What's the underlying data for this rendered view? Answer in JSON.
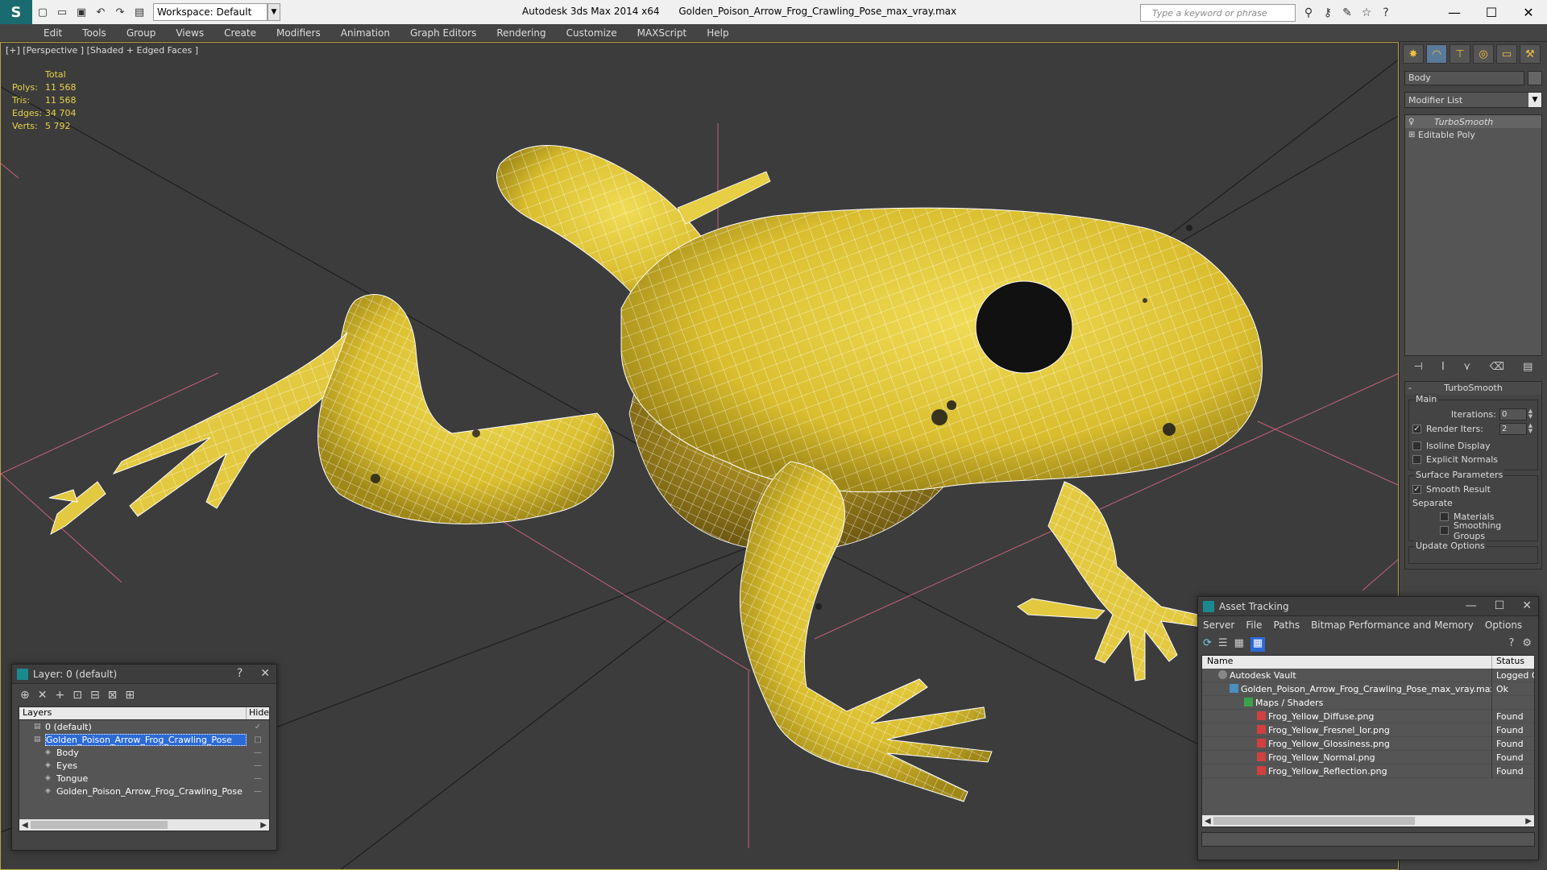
{
  "titlebar": {
    "app_name": "Autodesk 3ds Max  2014 x64",
    "file_name": "Golden_Poison_Arrow_Frog_Crawling_Pose_max_vray.max",
    "workspace": "Workspace: Default",
    "search_placeholder": "Type a keyword or phrase"
  },
  "menu": [
    "Edit",
    "Tools",
    "Group",
    "Views",
    "Create",
    "Modifiers",
    "Animation",
    "Graph Editors",
    "Rendering",
    "Customize",
    "MAXScript",
    "Help"
  ],
  "viewport": {
    "label": "[+] [Perspective ] [Shaded + Edged Faces ]",
    "stats": {
      "header": "Total",
      "rows": [
        {
          "key": "Polys:",
          "value": "11 568"
        },
        {
          "key": "Tris:",
          "value": "11 568"
        },
        {
          "key": "Edges:",
          "value": "34 704"
        },
        {
          "key": "Verts:",
          "value": "5 792"
        }
      ]
    }
  },
  "command_panel": {
    "object_name": "Body",
    "modifier_list": "Modifier List",
    "stack": [
      "TurboSmooth",
      "Editable Poly"
    ],
    "rollout": {
      "title": "TurboSmooth",
      "main_group": "Main",
      "iterations_label": "Iterations:",
      "iterations_value": "0",
      "render_iters_label": "Render Iters:",
      "render_iters_value": "2",
      "isoline_label": "Isoline Display",
      "explicit_normals_label": "Explicit Normals",
      "surface_group": "Surface Parameters",
      "smooth_result_label": "Smooth Result",
      "separate_label": "Separate",
      "materials_label": "Materials",
      "smoothing_groups_label": "Smoothing Groups",
      "update_options_label": "Update Options"
    }
  },
  "layer_window": {
    "title": "Layer: 0 (default)",
    "help": "?",
    "col_layers": "Layers",
    "col_hide": "Hide",
    "rows": [
      {
        "name": "0 (default)",
        "indent": 1,
        "checked": true
      },
      {
        "name": "Golden_Poison_Arrow_Frog_Crawling_Pose",
        "indent": 1,
        "selected": true
      },
      {
        "name": "Body",
        "indent": 2
      },
      {
        "name": "Eyes",
        "indent": 2
      },
      {
        "name": "Tongue",
        "indent": 2
      },
      {
        "name": "Golden_Poison_Arrow_Frog_Crawling_Pose",
        "indent": 2
      }
    ]
  },
  "asset_window": {
    "title": "Asset Tracking",
    "menu": [
      "Server",
      "File",
      "Paths",
      "Bitmap Performance and Memory",
      "Options"
    ],
    "col_name": "Name",
    "col_status": "Status",
    "rows": [
      {
        "name": "Autodesk Vault",
        "status": "Logged O",
        "indent": 1,
        "icon": "vault"
      },
      {
        "name": "Golden_Poison_Arrow_Frog_Crawling_Pose_max_vray.max",
        "status": "Ok",
        "indent": 2,
        "icon": "max"
      },
      {
        "name": "Maps / Shaders",
        "status": "",
        "indent": 3,
        "icon": "maps"
      },
      {
        "name": "Frog_Yellow_Diffuse.png",
        "status": "Found",
        "indent": 4,
        "icon": "png"
      },
      {
        "name": "Frog_Yellow_Fresnel_Ior.png",
        "status": "Found",
        "indent": 4,
        "icon": "png"
      },
      {
        "name": "Frog_Yellow_Glossiness.png",
        "status": "Found",
        "indent": 4,
        "icon": "png"
      },
      {
        "name": "Frog_Yellow_Normal.png",
        "status": "Found",
        "indent": 4,
        "icon": "png"
      },
      {
        "name": "Frog_Yellow_Reflection.png",
        "status": "Found",
        "indent": 4,
        "icon": "png"
      }
    ]
  },
  "colors": {
    "frog": "#e2c83a",
    "grid": "#c8607a",
    "stats": "#e8d44a",
    "selection": "#2c6ad6"
  }
}
